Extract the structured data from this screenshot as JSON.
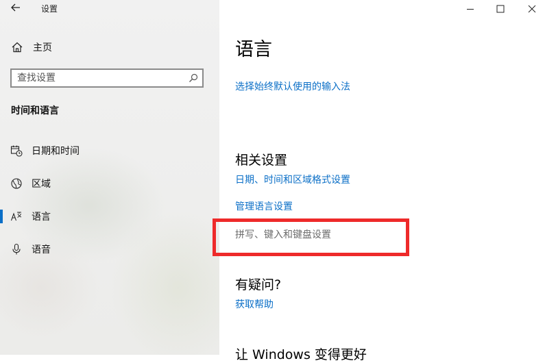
{
  "window": {
    "title": "设置"
  },
  "sidebar": {
    "home_label": "主页",
    "search_placeholder": "查找设置",
    "section_title": "时间和语言",
    "items": [
      {
        "label": "日期和时间",
        "icon": "calendar-clock-icon",
        "selected": false
      },
      {
        "label": "区域",
        "icon": "globe-icon",
        "selected": false
      },
      {
        "label": "语言",
        "icon": "language-icon",
        "selected": true
      },
      {
        "label": "语音",
        "icon": "microphone-icon",
        "selected": false
      }
    ]
  },
  "main": {
    "title": "语言",
    "input_method_link": "选择始终默认使用的输入法",
    "related_heading": "相关设置",
    "related_links": [
      "日期、时间和区域格式设置",
      "管理语言设置",
      "拼写、键入和键盘设置"
    ],
    "question_heading": "有疑问?",
    "help_link": "获取帮助",
    "improve_heading": "让 Windows 变得更好"
  },
  "colors": {
    "accent": "#0b6fc7",
    "highlight": "#ee2a2a"
  }
}
